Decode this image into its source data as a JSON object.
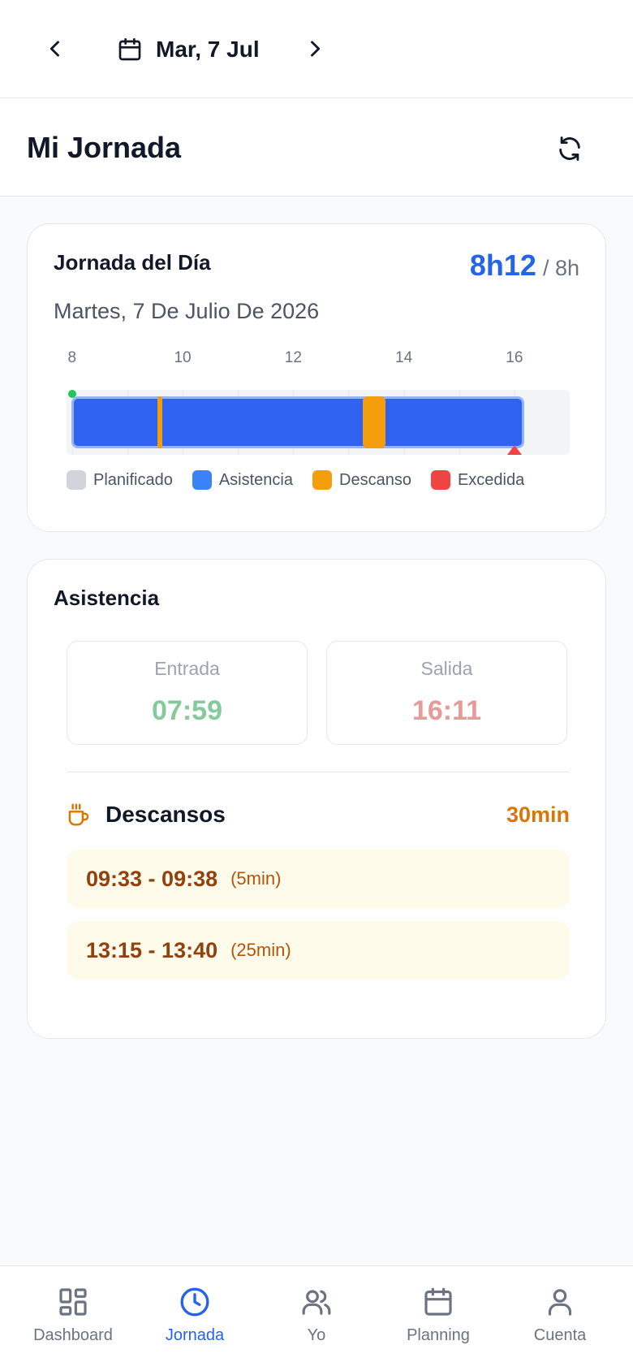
{
  "topbar": {
    "date_label": "Mar, 7 Jul",
    "prev_icon": "chevron-left-icon",
    "next_icon": "chevron-right-icon",
    "calendar_icon": "calendar-icon"
  },
  "header": {
    "title": "Mi Jornada",
    "refresh_icon": "refresh-icon"
  },
  "day_card": {
    "title": "Jornada del Día",
    "worked": "8h12",
    "planned": "/ 8h",
    "date_long": "Martes, 7 De Julio De 2026",
    "timeline": {
      "ticks": [
        "8",
        "10",
        "12",
        "14",
        "16"
      ],
      "range_start_hour": 7.9,
      "range_end_hour": 17.0,
      "planned": {
        "start": "08:00",
        "end": "16:00"
      },
      "attendance": {
        "start": "07:59",
        "end": "16:11"
      },
      "breaks": [
        {
          "start": "09:33",
          "end": "09:38"
        },
        {
          "start": "13:15",
          "end": "13:40"
        }
      ],
      "exceeded_marker": "16:00"
    },
    "legend": [
      {
        "label": "Planificado",
        "color": "#d1d5db"
      },
      {
        "label": "Asistencia",
        "color": "#3b82f6"
      },
      {
        "label": "Descanso",
        "color": "#f59e0b"
      },
      {
        "label": "Excedida",
        "color": "#ef4444"
      }
    ]
  },
  "attendance_card": {
    "title": "Asistencia",
    "entry": {
      "label": "Entrada",
      "value": "07:59",
      "color": "#86c99a"
    },
    "exit": {
      "label": "Salida",
      "value": "16:11",
      "color": "#e89a9a"
    },
    "breaks": {
      "title": "Descansos",
      "icon": "coffee-cup-icon",
      "total": "30min",
      "items": [
        {
          "range": "09:33 - 09:38",
          "duration": "(5min)"
        },
        {
          "range": "13:15 - 13:40",
          "duration": "(25min)"
        }
      ]
    }
  },
  "bottom_nav": {
    "items": [
      {
        "label": "Dashboard",
        "icon": "dashboard-grid-icon",
        "active": false
      },
      {
        "label": "Jornada",
        "icon": "clock-icon",
        "active": true
      },
      {
        "label": "Yo",
        "icon": "users-icon",
        "active": false
      },
      {
        "label": "Planning",
        "icon": "calendar-icon",
        "active": false
      },
      {
        "label": "Cuenta",
        "icon": "user-icon",
        "active": false
      }
    ],
    "active_color": "#2563eb",
    "inactive_color": "#6b7280"
  }
}
